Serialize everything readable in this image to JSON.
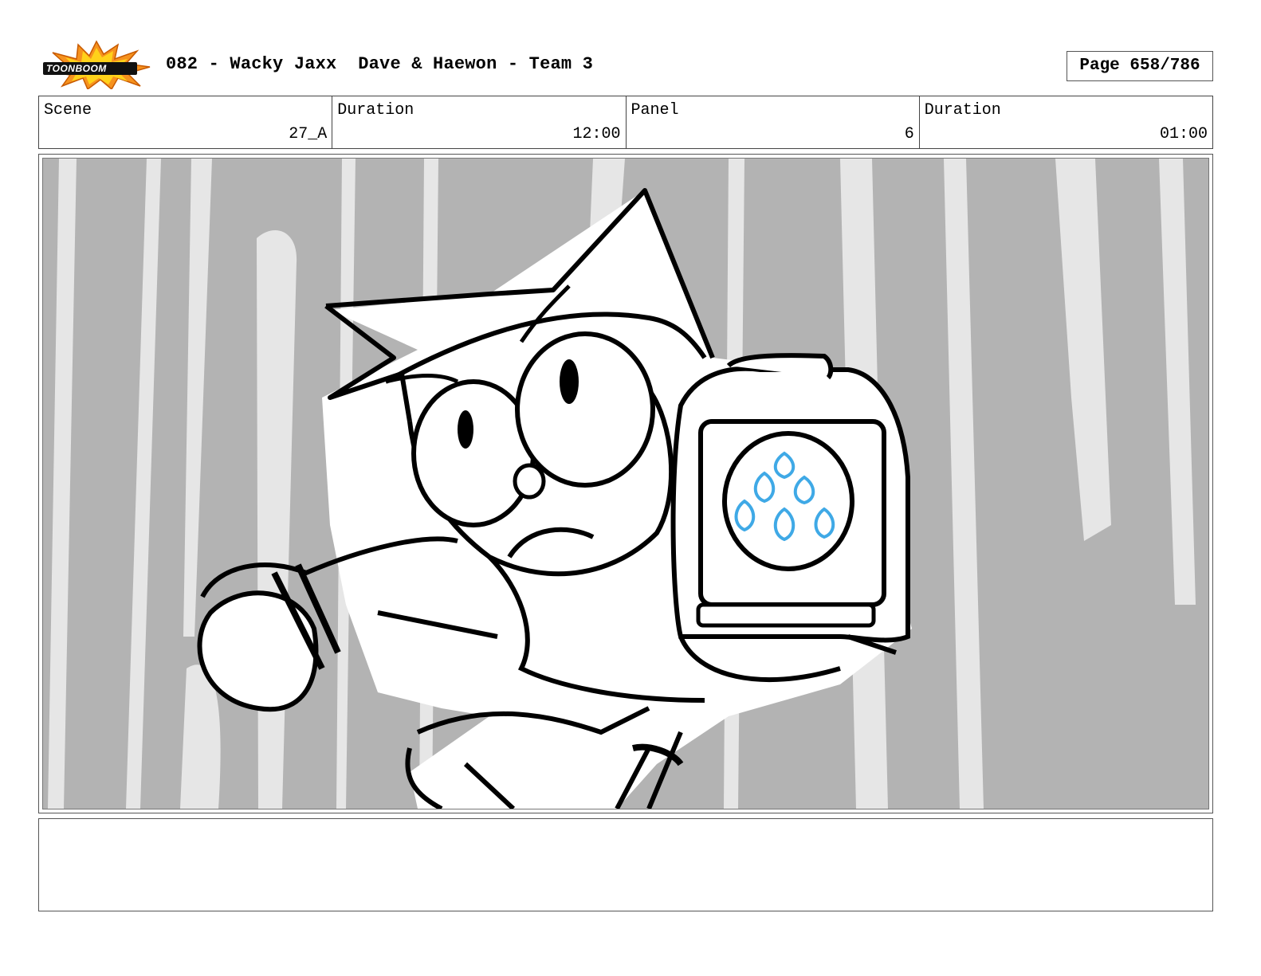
{
  "header": {
    "logo_text": "TOONBOOM",
    "title": "082 - Wacky Jaxx  Dave & Haewon - Team 3",
    "page": "Page 658/786"
  },
  "info": {
    "scene_label": "Scene",
    "scene_value": "27_A",
    "scene_duration_label": "Duration",
    "scene_duration_value": "12:00",
    "panel_label": "Panel",
    "panel_value": "6",
    "panel_duration_label": "Duration",
    "panel_duration_value": "01:00"
  },
  "notes": {
    "text": ""
  },
  "colors": {
    "panel_background": "#b3b3b3",
    "streak": "#e6e6e6",
    "flame_icon": "#3fa9e6"
  }
}
